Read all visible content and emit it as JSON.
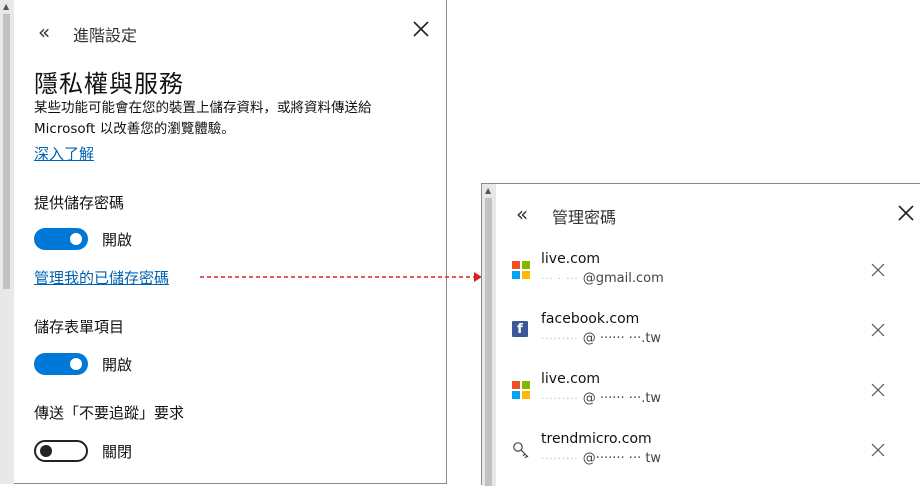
{
  "advanced_settings": {
    "back_icon": "double-chevron-left-icon",
    "title": "進階設定",
    "close_icon": "close-icon",
    "section_title": "隱私權與服務",
    "description": "某些功能可能會在您的裝置上儲存資料，或將資料傳送給 Microsoft 以改善您的瀏覽體驗。",
    "learn_more": "深入了解",
    "offer_save_passwords": {
      "label": "提供儲存密碼",
      "state": "開啟",
      "on": true
    },
    "manage_passwords_link": "管理我的已儲存密碼",
    "save_form_entries": {
      "label": "儲存表單項目",
      "state": "開啟",
      "on": true
    },
    "do_not_track": {
      "label": "傳送「不要追蹤」要求",
      "state": "關閉",
      "on": false
    }
  },
  "manage_passwords": {
    "back_icon": "double-chevron-left-icon",
    "title": "管理密碼",
    "close_icon": "close-icon",
    "entries": [
      {
        "site": "live.com",
        "user_masked": "··· · ···",
        "user_suffix": "@gmail.com",
        "icon": "microsoft-icon"
      },
      {
        "site": "facebook.com",
        "user_masked": "·········",
        "user_suffix": "@ ······  ···.tw",
        "icon": "facebook-icon"
      },
      {
        "site": "live.com",
        "user_masked": "·········",
        "user_suffix": "@ ······  ···.tw",
        "icon": "microsoft-icon"
      },
      {
        "site": "trendmicro.com",
        "user_masked": "·········",
        "user_suffix": "@······· ··· tw",
        "icon": "key-icon"
      }
    ]
  },
  "colors": {
    "accent": "#0078d7",
    "link": "#0063b1",
    "connector": "#e02020",
    "ms_red": "#f25022",
    "ms_green": "#7fba00",
    "ms_blue": "#00a4ef",
    "ms_yellow": "#ffb900",
    "facebook": "#3b5998"
  }
}
